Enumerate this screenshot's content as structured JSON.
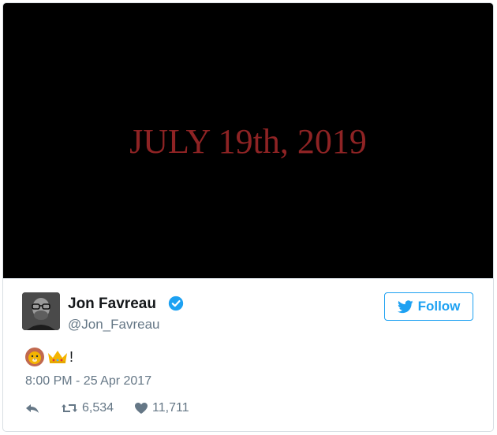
{
  "media": {
    "text": "JULY 19th, 2019"
  },
  "author": {
    "name": "Jon Favreau",
    "handle": "@Jon_Favreau"
  },
  "follow_button": {
    "label": "Follow"
  },
  "tweet": {
    "text_suffix": "!",
    "emojis": [
      "lion-face",
      "crown"
    ]
  },
  "timestamp": "8:00 PM - 25 Apr 2017",
  "actions": {
    "retweets": "6,534",
    "likes": "11,711"
  },
  "colors": {
    "accent": "#1da1f2",
    "media_text": "#8e2324",
    "muted": "#657786"
  },
  "icons": [
    "verified-badge-icon",
    "twitter-bird-icon",
    "reply-icon",
    "retweet-icon",
    "heart-icon"
  ]
}
